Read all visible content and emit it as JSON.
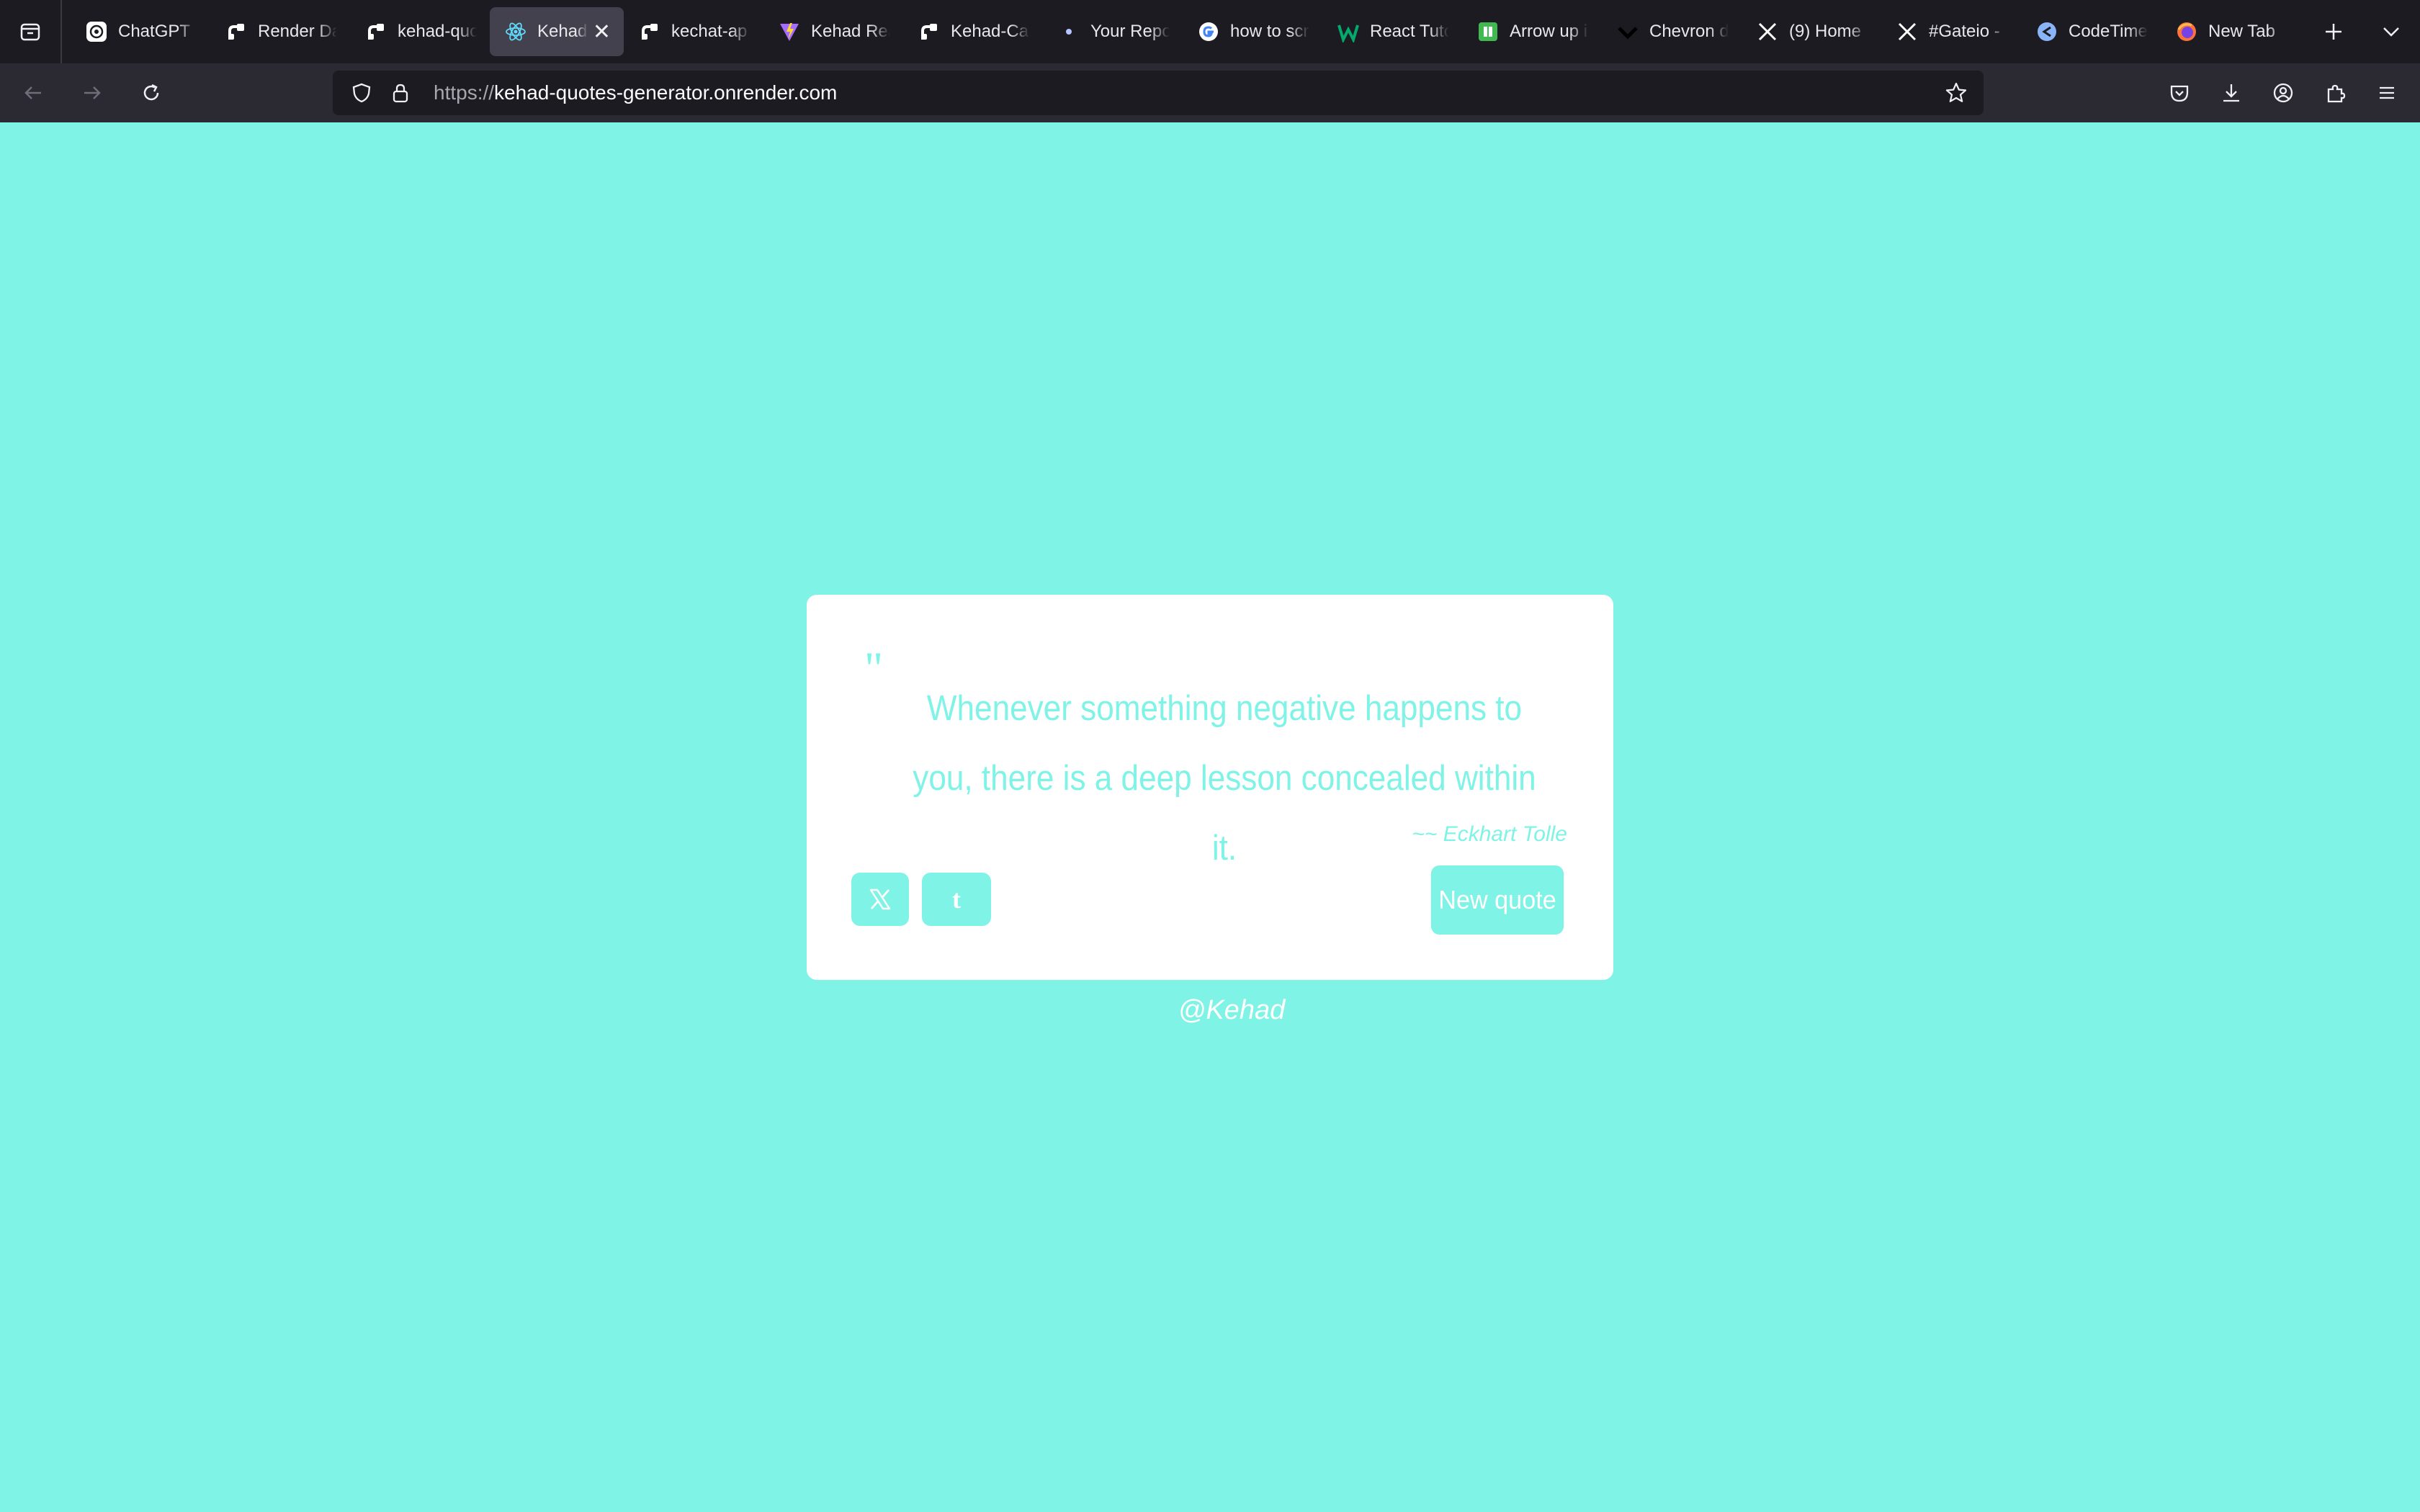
{
  "browser": {
    "tabs": [
      {
        "title": "ChatGPT",
        "icon": "chatgpt-icon",
        "active": false
      },
      {
        "title": "Render Da",
        "icon": "render-icon",
        "active": false
      },
      {
        "title": "kehad-quo",
        "icon": "render-icon",
        "active": false
      },
      {
        "title": "Kehad Q",
        "icon": "react-icon",
        "active": true
      },
      {
        "title": "kechat-ap",
        "icon": "render-icon",
        "active": false
      },
      {
        "title": "Kehad Rea",
        "icon": "vite-icon",
        "active": false
      },
      {
        "title": "Kehad-Ca",
        "icon": "render-icon",
        "active": false
      },
      {
        "title": "Your Repo",
        "icon": "dot-icon",
        "active": false
      },
      {
        "title": "how to scr",
        "icon": "google-icon",
        "active": false
      },
      {
        "title": "React Tuto",
        "icon": "w3schools-icon",
        "active": false
      },
      {
        "title": "Arrow up i",
        "icon": "green-square-icon",
        "active": false
      },
      {
        "title": "Chevron d",
        "icon": "chevron-icon",
        "active": false
      },
      {
        "title": "(9) Home",
        "icon": "x-icon",
        "active": false
      },
      {
        "title": "#Gateio -",
        "icon": "x-icon",
        "active": false
      },
      {
        "title": "CodeTime",
        "icon": "codetime-icon",
        "active": false
      },
      {
        "title": "New Tab",
        "icon": "firefox-icon",
        "active": false
      }
    ],
    "url_scheme": "https://",
    "url_host": "kehad-quotes-generator.onrender.com"
  },
  "colors": {
    "background": "#7ff3e5",
    "card": "#ffffff",
    "accent": "#7ff3e5"
  },
  "quote": {
    "mark": "\"",
    "text": "Whenever something negative happens to you, there is a deep lesson concealed within it.",
    "author": "~~ Eckhart Tolle"
  },
  "buttons": {
    "twitter_icon": "x-logo-icon",
    "tumblr_icon": "tumblr-icon",
    "tumblr_glyph": "t",
    "new_quote": "New quote"
  },
  "footer": {
    "handle": "@Kehad"
  }
}
